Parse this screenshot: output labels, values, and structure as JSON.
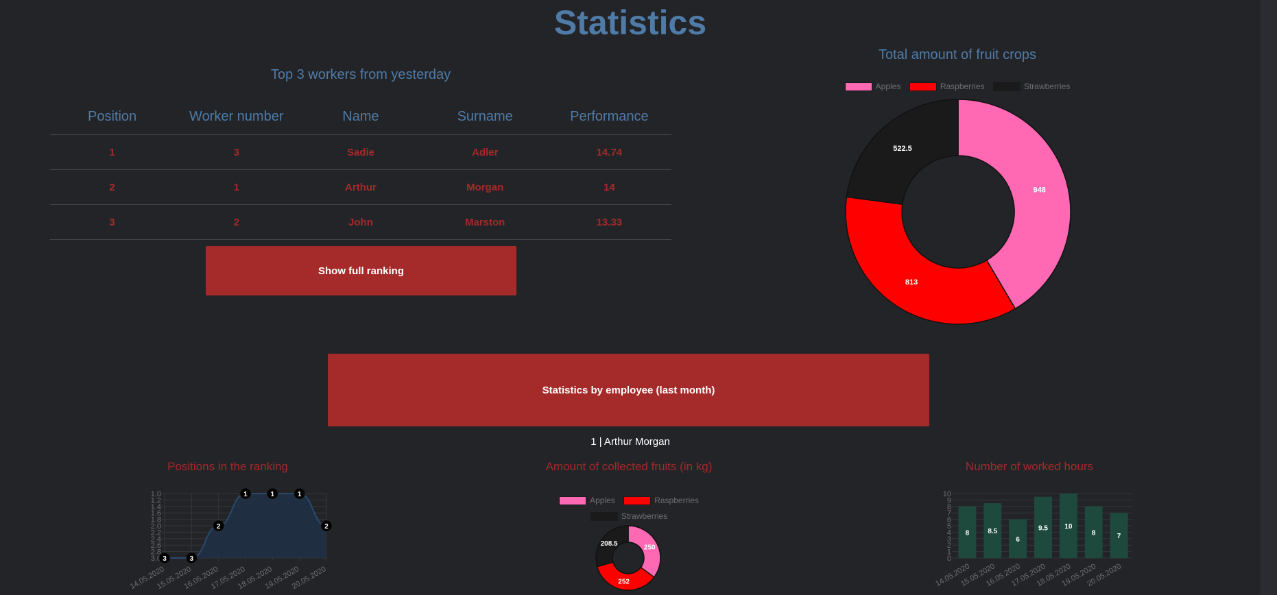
{
  "page_title": "Statistics",
  "top_workers": {
    "title": "Top 3 workers from yesterday",
    "columns": [
      "Position",
      "Worker number",
      "Name",
      "Surname",
      "Performance"
    ],
    "rows": [
      [
        "1",
        "3",
        "Sadie",
        "Adler",
        "14.74"
      ],
      [
        "2",
        "1",
        "Arthur",
        "Morgan",
        "14"
      ],
      [
        "3",
        "2",
        "John",
        "Marston",
        "13.33"
      ]
    ],
    "button_label": "Show full ranking"
  },
  "stats_button_label": "Statistics by employee (last month)",
  "selected_worker": "1 | Arthur Morgan",
  "colors": {
    "apples": "#ff69b4",
    "raspberries": "#ff0000",
    "strawberries": "#1a1a1a",
    "accent": "#a52a2a",
    "title": "#4f7ba7",
    "bars": "#1e4a3e"
  },
  "chart_data": [
    {
      "type": "pie",
      "title": "Total amount of fruit crops",
      "categories": [
        "Apples",
        "Raspberries",
        "Strawberries"
      ],
      "values": [
        948,
        813,
        522.5
      ],
      "value_labels": [
        "948",
        "813",
        "522.5"
      ],
      "donut": true,
      "legend": "top"
    },
    {
      "type": "area",
      "title": "Positions in the ranking",
      "x": [
        "14.05.2020",
        "15.05.2020",
        "16.05.2020",
        "17.05.2020",
        "18.05.2020",
        "19.05.2020",
        "20.05.2020"
      ],
      "values": [
        3,
        3,
        2,
        1,
        1,
        1,
        2
      ],
      "value_labels": [
        "3",
        "3",
        "2",
        "1",
        "1",
        "1",
        "2"
      ],
      "y_ticks": [
        "1.0",
        "1.2",
        "1.4",
        "1.6",
        "1.8",
        "2.0",
        "2.2",
        "2.4",
        "2.6",
        "2.8",
        "3.0"
      ],
      "ylim": [
        1,
        3
      ],
      "y_reversed": true,
      "grid": true
    },
    {
      "type": "pie",
      "title": "Amount of collected fruits (in kg)",
      "categories": [
        "Apples",
        "Raspberries",
        "Strawberries"
      ],
      "values": [
        250,
        252,
        208.5
      ],
      "value_labels": [
        "250",
        "252",
        "208.5"
      ],
      "donut": true,
      "legend": "top"
    },
    {
      "type": "bar",
      "title": "Number of worked hours",
      "categories": [
        "14.05.2020",
        "15.05.2020",
        "16.05.2020",
        "17.05.2020",
        "18.05.2020",
        "19.05.2020",
        "20.05.2020"
      ],
      "values": [
        8,
        8.5,
        6,
        9.5,
        10,
        8,
        7
      ],
      "value_labels": [
        "8",
        "8.5",
        "6",
        "9.5",
        "10",
        "8",
        "7"
      ],
      "y_ticks": [
        "0",
        "1",
        "2",
        "3",
        "4",
        "5",
        "6",
        "7",
        "8",
        "9",
        "10"
      ],
      "ylim": [
        0,
        10
      ],
      "grid": true
    }
  ]
}
